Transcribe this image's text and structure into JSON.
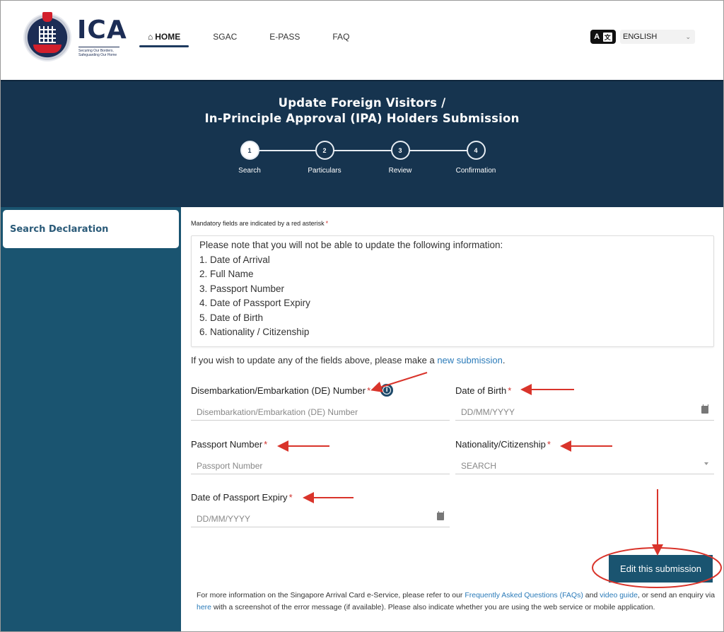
{
  "header": {
    "logo": {
      "wordmark": "ICA",
      "tagline": "Securing Our Borders, Safeguarding Our Home"
    },
    "nav": [
      {
        "label": "HOME",
        "icon": "home-icon",
        "active": true
      },
      {
        "label": "SGAC",
        "active": false
      },
      {
        "label": "E-PASS",
        "active": false
      },
      {
        "label": "FAQ",
        "active": false
      }
    ],
    "language": {
      "icon": "language-icon",
      "icon_left": "A",
      "icon_right": "文",
      "selected": "ENGLISH",
      "chevron": "⌄"
    }
  },
  "hero": {
    "title_line1": "Update Foreign Visitors /",
    "title_line2": "In-Principle Approval (IPA) Holders Submission",
    "steps": [
      {
        "number": "1",
        "label": "Search",
        "active": true
      },
      {
        "number": "2",
        "label": "Particulars",
        "active": false
      },
      {
        "number": "3",
        "label": "Review",
        "active": false
      },
      {
        "number": "4",
        "label": "Confirmation",
        "active": false
      }
    ]
  },
  "sidebar": {
    "items": [
      {
        "label": "Search Declaration",
        "active": true
      }
    ]
  },
  "main": {
    "mandatory_note": "Mandatory fields are indicated by a red asterisk",
    "asterisk": "*",
    "notice": {
      "intro": "Please note that you will not be able to update the following information:",
      "items": [
        "1. Date of Arrival",
        "2. Full Name",
        "3. Passport Number",
        "4. Date of Passport Expiry",
        "5. Date of Birth",
        "6. Nationality / Citizenship"
      ]
    },
    "update_text_prefix": "If you wish to update any of the fields above, please make a ",
    "update_link": "new submission",
    "update_text_suffix": ".",
    "fields": {
      "de_number": {
        "label": "Disembarkation/Embarkation (DE) Number",
        "placeholder": "Disembarkation/Embarkation (DE) Number",
        "value": "",
        "info_icon": "i"
      },
      "dob": {
        "label": "Date of Birth",
        "placeholder": "DD/MM/YYYY",
        "value": "",
        "icon": "calendar-icon"
      },
      "passport": {
        "label": "Passport Number",
        "placeholder": "Passport Number",
        "value": ""
      },
      "nationality": {
        "label": "Nationality/Citizenship",
        "placeholder": "SEARCH",
        "value": "",
        "icon": "caret-down-icon"
      },
      "passport_expiry": {
        "label": "Date of Passport Expiry",
        "placeholder": "DD/MM/YYYY",
        "value": "",
        "icon": "calendar-icon"
      }
    },
    "submit_label": "Edit this submission",
    "footer": {
      "part1": "For more information on the Singapore Arrival Card e-Service, please refer to our ",
      "link_faq": "Frequently Asked Questions (FAQs)",
      "part2": " and ",
      "link_video": "video guide",
      "part3": ", or send an enquiry via ",
      "link_here": "here",
      "part4": " with a screenshot of the error message (if available). Please also indicate whether you are using the web service or mobile application."
    }
  },
  "colors": {
    "brand_navy": "#16344f",
    "sidebar_teal": "#1a5470",
    "link_blue": "#2b7bb9",
    "required_red": "#d0312d",
    "annotation_red": "#d9342b"
  }
}
